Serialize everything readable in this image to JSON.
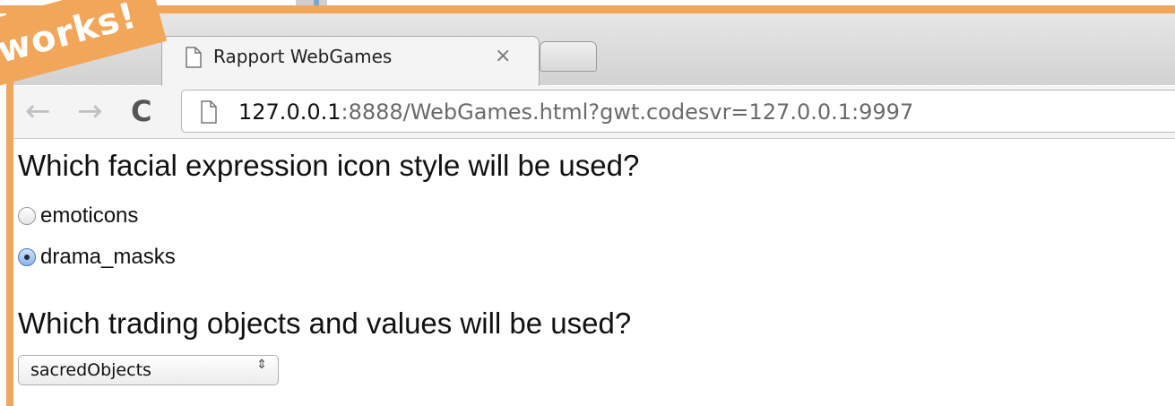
{
  "annotation": {
    "banner_text": "works!"
  },
  "browser": {
    "tab_title": "Rapport WebGames",
    "tab_close": "×",
    "nav_back": "←",
    "nav_forward": "→",
    "nav_reload": "C",
    "url_host": "127.0.0.1",
    "url_rest": ":8888/WebGames.html?gwt.codesvr=127.0.0.1:9997"
  },
  "page": {
    "question1": "Which facial expression icon style will be used?",
    "icon_style_options": [
      {
        "label": "emoticons",
        "checked": false
      },
      {
        "label": "drama_masks",
        "checked": true
      }
    ],
    "question2": "Which trading objects and values will be used?",
    "trading_select": {
      "value": "sacredObjects",
      "arrows": "⇕"
    }
  },
  "colors": {
    "annotation_orange": "#f2a65a",
    "radio_checked": "#8ab4ec"
  }
}
